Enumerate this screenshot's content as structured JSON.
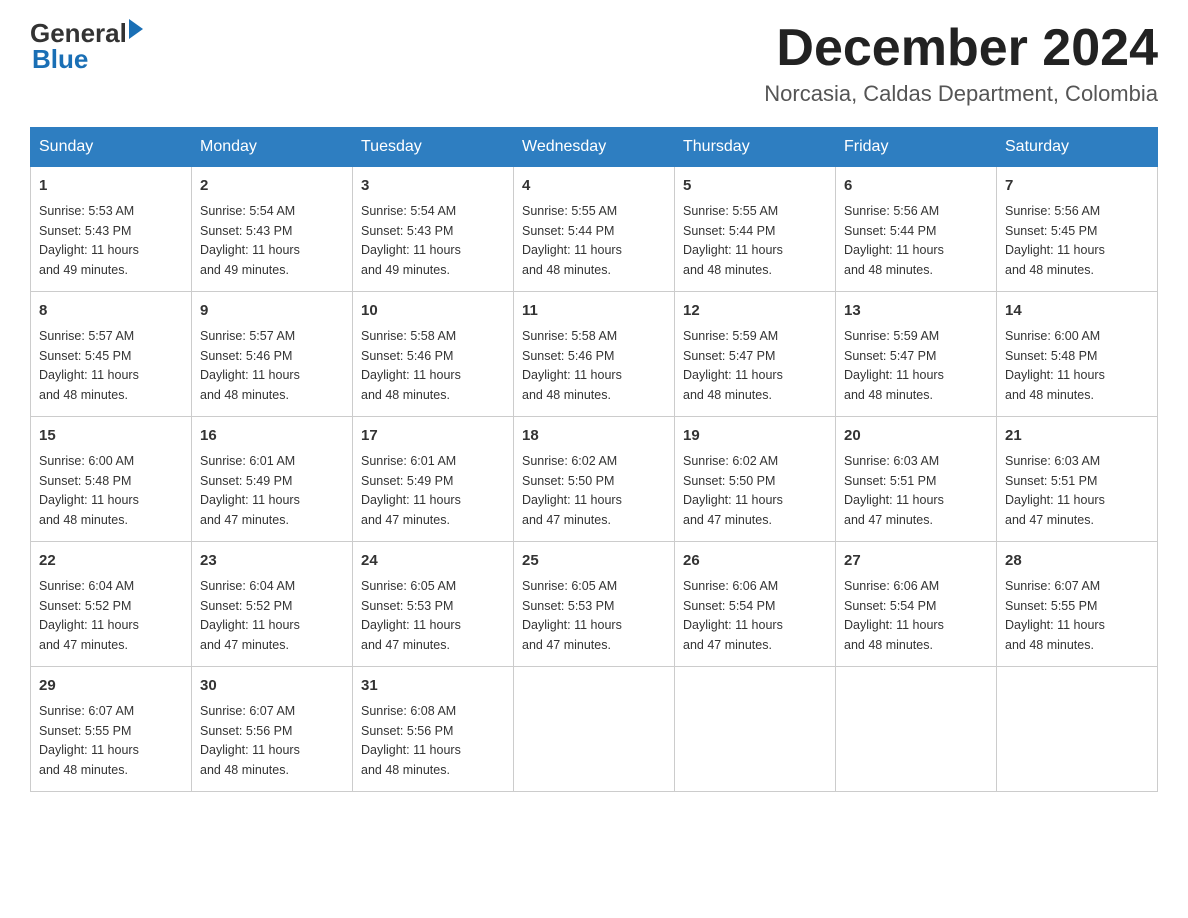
{
  "logo": {
    "general": "General",
    "blue": "Blue"
  },
  "title": "December 2024",
  "location": "Norcasia, Caldas Department, Colombia",
  "days_of_week": [
    "Sunday",
    "Monday",
    "Tuesday",
    "Wednesday",
    "Thursday",
    "Friday",
    "Saturday"
  ],
  "weeks": [
    [
      {
        "day": "1",
        "sunrise": "5:53 AM",
        "sunset": "5:43 PM",
        "daylight": "11 hours and 49 minutes."
      },
      {
        "day": "2",
        "sunrise": "5:54 AM",
        "sunset": "5:43 PM",
        "daylight": "11 hours and 49 minutes."
      },
      {
        "day": "3",
        "sunrise": "5:54 AM",
        "sunset": "5:43 PM",
        "daylight": "11 hours and 49 minutes."
      },
      {
        "day": "4",
        "sunrise": "5:55 AM",
        "sunset": "5:44 PM",
        "daylight": "11 hours and 48 minutes."
      },
      {
        "day": "5",
        "sunrise": "5:55 AM",
        "sunset": "5:44 PM",
        "daylight": "11 hours and 48 minutes."
      },
      {
        "day": "6",
        "sunrise": "5:56 AM",
        "sunset": "5:44 PM",
        "daylight": "11 hours and 48 minutes."
      },
      {
        "day": "7",
        "sunrise": "5:56 AM",
        "sunset": "5:45 PM",
        "daylight": "11 hours and 48 minutes."
      }
    ],
    [
      {
        "day": "8",
        "sunrise": "5:57 AM",
        "sunset": "5:45 PM",
        "daylight": "11 hours and 48 minutes."
      },
      {
        "day": "9",
        "sunrise": "5:57 AM",
        "sunset": "5:46 PM",
        "daylight": "11 hours and 48 minutes."
      },
      {
        "day": "10",
        "sunrise": "5:58 AM",
        "sunset": "5:46 PM",
        "daylight": "11 hours and 48 minutes."
      },
      {
        "day": "11",
        "sunrise": "5:58 AM",
        "sunset": "5:46 PM",
        "daylight": "11 hours and 48 minutes."
      },
      {
        "day": "12",
        "sunrise": "5:59 AM",
        "sunset": "5:47 PM",
        "daylight": "11 hours and 48 minutes."
      },
      {
        "day": "13",
        "sunrise": "5:59 AM",
        "sunset": "5:47 PM",
        "daylight": "11 hours and 48 minutes."
      },
      {
        "day": "14",
        "sunrise": "6:00 AM",
        "sunset": "5:48 PM",
        "daylight": "11 hours and 48 minutes."
      }
    ],
    [
      {
        "day": "15",
        "sunrise": "6:00 AM",
        "sunset": "5:48 PM",
        "daylight": "11 hours and 48 minutes."
      },
      {
        "day": "16",
        "sunrise": "6:01 AM",
        "sunset": "5:49 PM",
        "daylight": "11 hours and 47 minutes."
      },
      {
        "day": "17",
        "sunrise": "6:01 AM",
        "sunset": "5:49 PM",
        "daylight": "11 hours and 47 minutes."
      },
      {
        "day": "18",
        "sunrise": "6:02 AM",
        "sunset": "5:50 PM",
        "daylight": "11 hours and 47 minutes."
      },
      {
        "day": "19",
        "sunrise": "6:02 AM",
        "sunset": "5:50 PM",
        "daylight": "11 hours and 47 minutes."
      },
      {
        "day": "20",
        "sunrise": "6:03 AM",
        "sunset": "5:51 PM",
        "daylight": "11 hours and 47 minutes."
      },
      {
        "day": "21",
        "sunrise": "6:03 AM",
        "sunset": "5:51 PM",
        "daylight": "11 hours and 47 minutes."
      }
    ],
    [
      {
        "day": "22",
        "sunrise": "6:04 AM",
        "sunset": "5:52 PM",
        "daylight": "11 hours and 47 minutes."
      },
      {
        "day": "23",
        "sunrise": "6:04 AM",
        "sunset": "5:52 PM",
        "daylight": "11 hours and 47 minutes."
      },
      {
        "day": "24",
        "sunrise": "6:05 AM",
        "sunset": "5:53 PM",
        "daylight": "11 hours and 47 minutes."
      },
      {
        "day": "25",
        "sunrise": "6:05 AM",
        "sunset": "5:53 PM",
        "daylight": "11 hours and 47 minutes."
      },
      {
        "day": "26",
        "sunrise": "6:06 AM",
        "sunset": "5:54 PM",
        "daylight": "11 hours and 47 minutes."
      },
      {
        "day": "27",
        "sunrise": "6:06 AM",
        "sunset": "5:54 PM",
        "daylight": "11 hours and 48 minutes."
      },
      {
        "day": "28",
        "sunrise": "6:07 AM",
        "sunset": "5:55 PM",
        "daylight": "11 hours and 48 minutes."
      }
    ],
    [
      {
        "day": "29",
        "sunrise": "6:07 AM",
        "sunset": "5:55 PM",
        "daylight": "11 hours and 48 minutes."
      },
      {
        "day": "30",
        "sunrise": "6:07 AM",
        "sunset": "5:56 PM",
        "daylight": "11 hours and 48 minutes."
      },
      {
        "day": "31",
        "sunrise": "6:08 AM",
        "sunset": "5:56 PM",
        "daylight": "11 hours and 48 minutes."
      },
      null,
      null,
      null,
      null
    ]
  ],
  "labels": {
    "sunrise": "Sunrise:",
    "sunset": "Sunset:",
    "daylight": "Daylight:"
  }
}
